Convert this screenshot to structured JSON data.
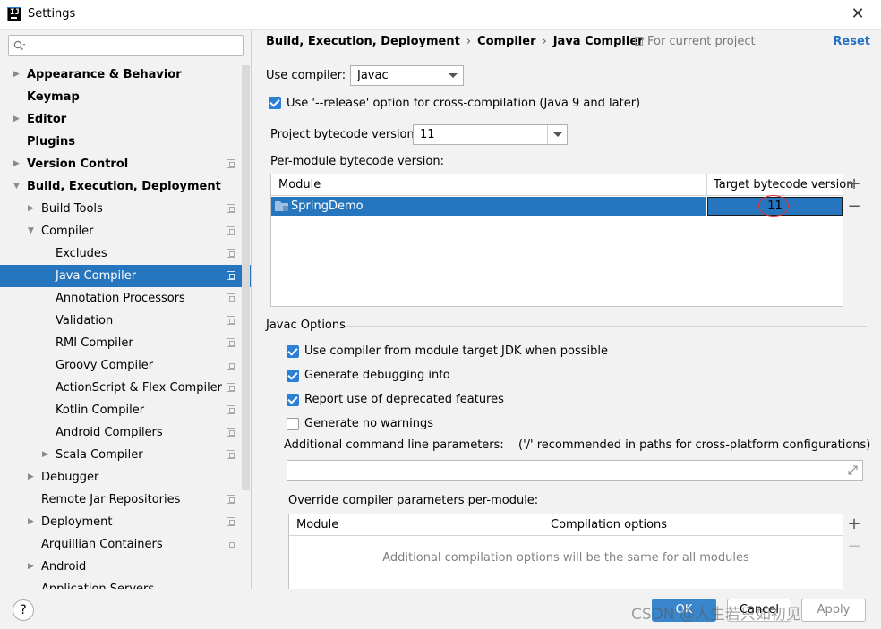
{
  "window": {
    "title": "Settings",
    "close_glyph": "✕"
  },
  "sidebar": {
    "search_placeholder": "",
    "items": [
      {
        "label": "Appearance & Behavior",
        "level": 0,
        "bold": true,
        "arrow": "right",
        "scope": false
      },
      {
        "label": "Keymap",
        "level": 0,
        "bold": true,
        "arrow": "none",
        "scope": false
      },
      {
        "label": "Editor",
        "level": 0,
        "bold": true,
        "arrow": "right",
        "scope": false
      },
      {
        "label": "Plugins",
        "level": 0,
        "bold": true,
        "arrow": "none",
        "scope": false
      },
      {
        "label": "Version Control",
        "level": 0,
        "bold": true,
        "arrow": "right",
        "scope": true
      },
      {
        "label": "Build, Execution, Deployment",
        "level": 0,
        "bold": true,
        "arrow": "down",
        "scope": false
      },
      {
        "label": "Build Tools",
        "level": 1,
        "bold": false,
        "arrow": "right",
        "scope": true
      },
      {
        "label": "Compiler",
        "level": 1,
        "bold": false,
        "arrow": "down",
        "scope": true
      },
      {
        "label": "Excludes",
        "level": 2,
        "bold": false,
        "arrow": "none",
        "scope": true
      },
      {
        "label": "Java Compiler",
        "level": 2,
        "bold": false,
        "arrow": "none",
        "scope": true,
        "selected": true
      },
      {
        "label": "Annotation Processors",
        "level": 2,
        "bold": false,
        "arrow": "none",
        "scope": true
      },
      {
        "label": "Validation",
        "level": 2,
        "bold": false,
        "arrow": "none",
        "scope": true
      },
      {
        "label": "RMI Compiler",
        "level": 2,
        "bold": false,
        "arrow": "none",
        "scope": true
      },
      {
        "label": "Groovy Compiler",
        "level": 2,
        "bold": false,
        "arrow": "none",
        "scope": true
      },
      {
        "label": "ActionScript & Flex Compiler",
        "level": 2,
        "bold": false,
        "arrow": "none",
        "scope": true
      },
      {
        "label": "Kotlin Compiler",
        "level": 2,
        "bold": false,
        "arrow": "none",
        "scope": true
      },
      {
        "label": "Android Compilers",
        "level": 2,
        "bold": false,
        "arrow": "none",
        "scope": true
      },
      {
        "label": "Scala Compiler",
        "level": 2,
        "bold": false,
        "arrow": "right",
        "scope": true
      },
      {
        "label": "Debugger",
        "level": 1,
        "bold": false,
        "arrow": "right",
        "scope": false
      },
      {
        "label": "Remote Jar Repositories",
        "level": 1,
        "bold": false,
        "arrow": "none",
        "scope": true
      },
      {
        "label": "Deployment",
        "level": 1,
        "bold": false,
        "arrow": "right",
        "scope": true
      },
      {
        "label": "Arquillian Containers",
        "level": 1,
        "bold": false,
        "arrow": "none",
        "scope": true
      },
      {
        "label": "Android",
        "level": 1,
        "bold": false,
        "arrow": "right",
        "scope": false
      },
      {
        "label": "Application Servers",
        "level": 1,
        "bold": false,
        "arrow": "none",
        "scope": false
      }
    ]
  },
  "header": {
    "breadcrumb": [
      "Build, Execution, Deployment",
      "Compiler",
      "Java Compiler"
    ],
    "separator": "›",
    "scope_note": "For current project",
    "reset": "Reset"
  },
  "compiler": {
    "use_compiler_label": "Use compiler:",
    "use_compiler_value": "Javac",
    "release_option_label": "Use '--release' option for cross-compilation (Java 9 and later)",
    "release_option_checked": true,
    "project_bytecode_label": "Project bytecode version:",
    "project_bytecode_value": "11",
    "per_module_label": "Per-module bytecode version:",
    "module_table": {
      "col_module": "Module",
      "col_target": "Target bytecode version",
      "rows": [
        {
          "module": "SpringDemo",
          "target": "11"
        }
      ],
      "add": "+",
      "remove": "−"
    }
  },
  "javac": {
    "section_title": "Javac Options",
    "options": [
      {
        "label": "Use compiler from module target JDK when possible",
        "checked": true
      },
      {
        "label": "Generate debugging info",
        "checked": true
      },
      {
        "label": "Report use of deprecated features",
        "checked": true
      },
      {
        "label": "Generate no warnings",
        "checked": false
      }
    ],
    "additional_params_label": "Additional command line parameters:",
    "additional_params_hint": "('/' recommended in paths for cross-platform configurations)",
    "additional_params_value": "",
    "override_label": "Override compiler parameters per-module:",
    "override_table": {
      "col_module": "Module",
      "col_options": "Compilation options",
      "empty_text": "Additional compilation options will be the same for all modules",
      "add": "+",
      "remove": "−"
    }
  },
  "footer": {
    "help": "?",
    "ok": "OK",
    "cancel": "Cancel",
    "apply": "Apply",
    "watermark": "CSDN @人生若只如初见"
  },
  "colors": {
    "selection": "#2675bf",
    "accent": "#2b7fd6",
    "link": "#2470c5"
  }
}
